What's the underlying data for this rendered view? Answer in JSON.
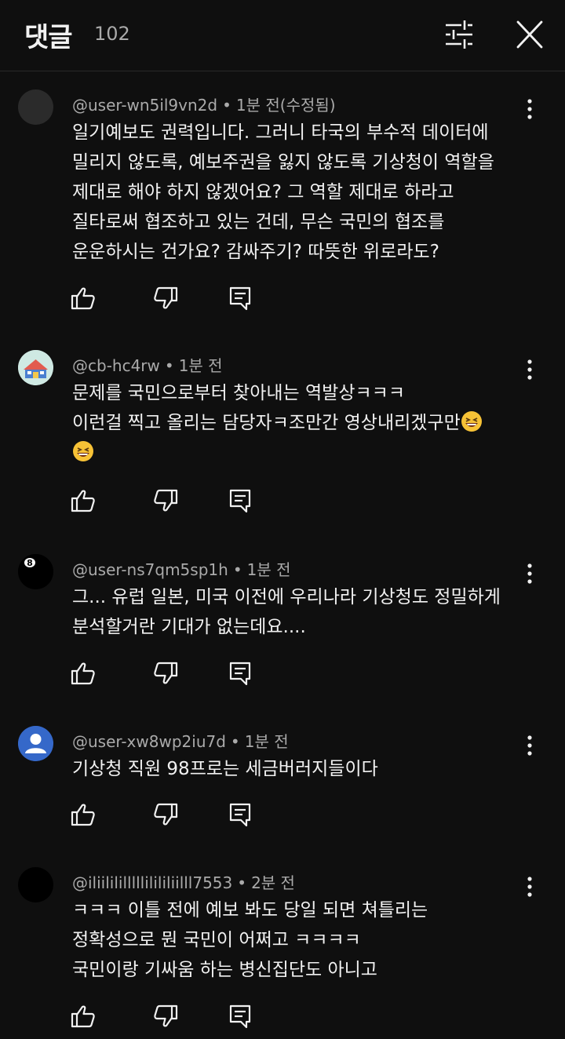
{
  "header": {
    "title": "댓글",
    "count": "102",
    "filter_icon": "sliders-icon",
    "close_icon": "close-icon"
  },
  "comments": [
    {
      "author": "@user-wn5il9vn2d",
      "time": "1분 전(수정됨)",
      "avatar_icon": "blank-avatar",
      "lines": [
        "일기예보도 권력입니다. 그러니 타국의 부수적 데이터에",
        "밀리지 않도록, 예보주권을 잃지 않도록 기상청이 역할을",
        "제대로 해야 하지 않겠어요? 그 역할 제대로 하라고",
        "질타로써 협조하고 있는 건데, 무슨 국민의 협조를",
        "운운하시는 건가요? 감싸주기? 따뜻한 위로라도?"
      ]
    },
    {
      "author": "@cb-hc4rw",
      "time": "1분 전",
      "avatar_icon": "house-avatar",
      "lines": [
        "문제를 국민으로부터 찾아내는 역발상ㅋㅋㅋ",
        "이런걸 찍고 올리는 담당자ㅋ조만간 영상내리겠구만",
        ""
      ],
      "emoji_icon": "grinning-squinting-face-emoji"
    },
    {
      "author": "@user-ns7qm5sp1h",
      "time": "1분 전",
      "avatar_icon": "eight-ball-avatar",
      "lines": [
        "그... 유럽 일본, 미국 이전에 우리나라 기상청도 정밀하게",
        "분석할거란 기대가 없는데요...."
      ]
    },
    {
      "author": "@user-xw8wp2iu7d",
      "time": "1분 전",
      "avatar_icon": "default-user-avatar",
      "lines": [
        "기상청 직원 98프로는 세금버러지들이다"
      ]
    },
    {
      "author": "@iliilililllllilililiilll7553",
      "time": "2분 전",
      "avatar_icon": "black-avatar",
      "lines": [
        "ㅋㅋㅋ 이틀 전에 예보 봐도 당일 되면 쳐틀리는",
        "정확성으로 뭔 국민이 어쩌고 ㅋㅋㅋㅋ",
        "국민이랑 기싸움 하는 병신집단도 아니고"
      ]
    }
  ],
  "actions": {
    "like_icon": "thumbs-up-icon",
    "dislike_icon": "thumbs-down-icon",
    "reply_icon": "reply-comment-icon",
    "more_icon": "more-vertical-icon"
  },
  "colors": {
    "background": "#0f0f0f",
    "text": "#f1f1f1",
    "secondary_text": "#aaaaaa",
    "avatar_blue": "#3568c9"
  }
}
